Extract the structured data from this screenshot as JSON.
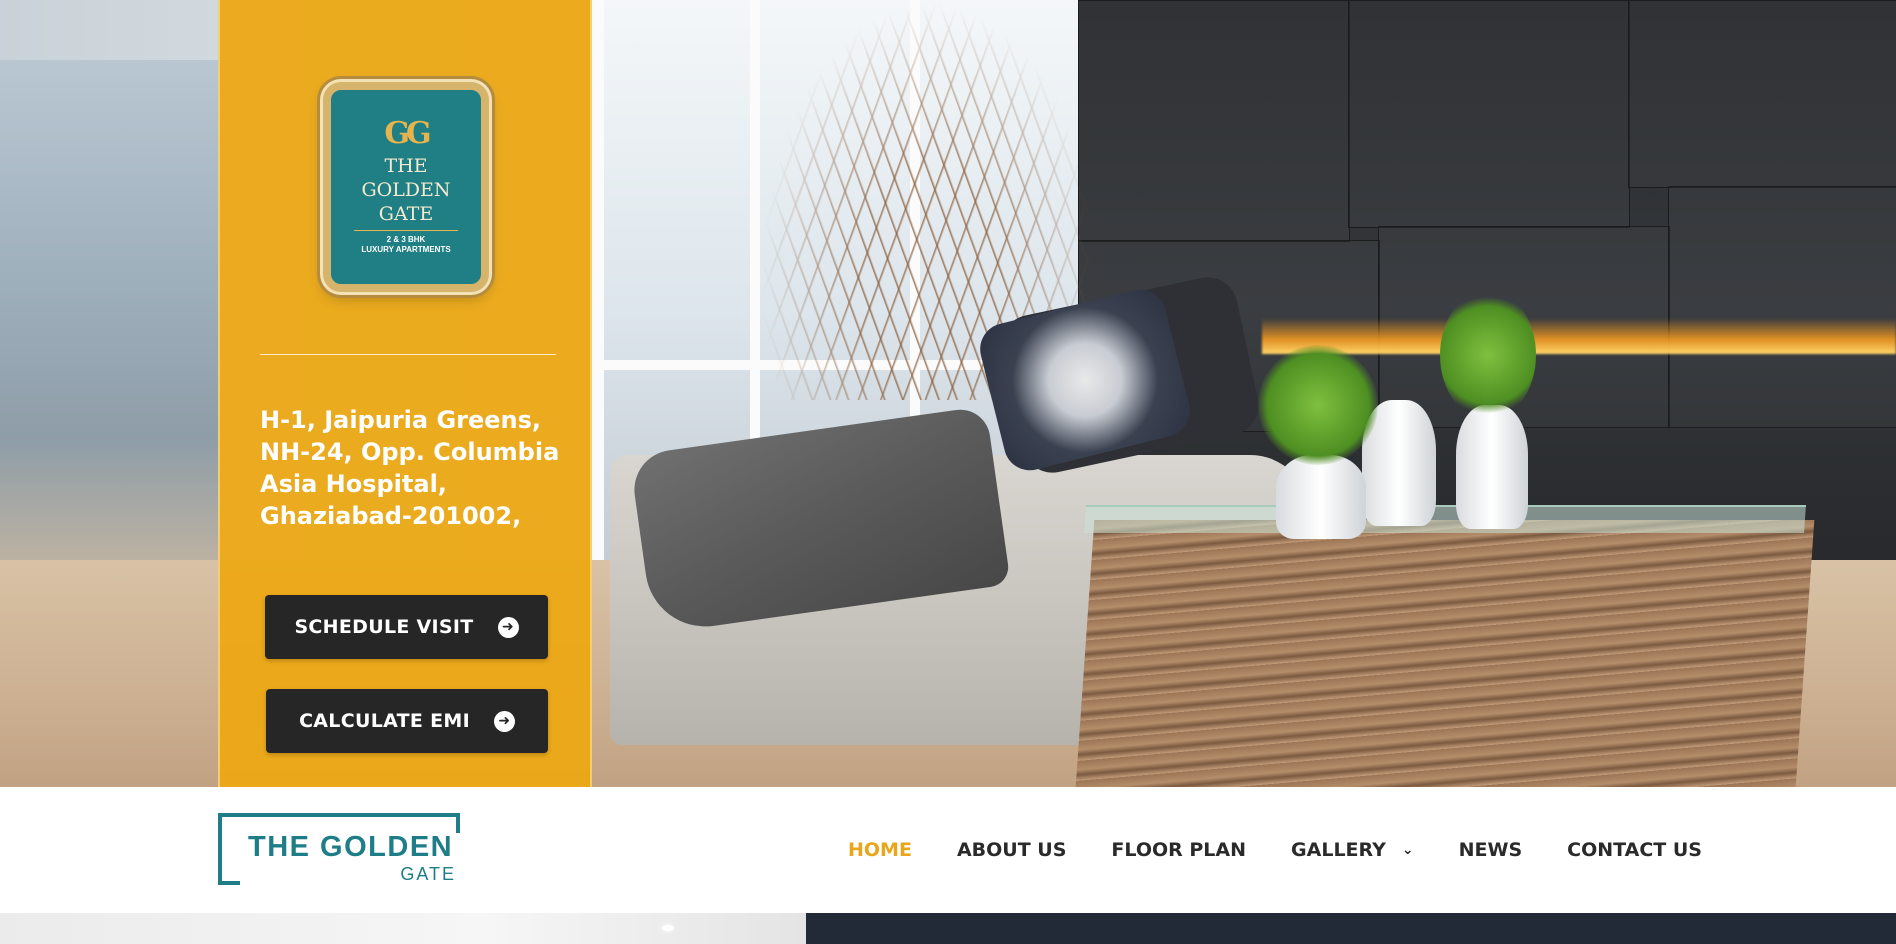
{
  "brand": {
    "emblem": {
      "monogram": "GG",
      "name_line1": "THE",
      "name_line2": "GOLDEN",
      "name_line3": "GATE",
      "tagline_line1": "2 & 3 BHK",
      "tagline_line2": "LUXURY APARTMENTS"
    },
    "logo": {
      "title": "THE GOLDEN",
      "subtitle": "GATE"
    }
  },
  "hero": {
    "address_lines": [
      "H-1, Jaipuria Greens,",
      "NH-24, Opp. Columbia",
      "Asia Hospital,",
      "Ghaziabad-201002,"
    ],
    "buttons": {
      "schedule_visit": "SCHEDULE VISIT",
      "calculate_emi": "CALCULATE EMI"
    },
    "arrow_icon": "arrow-circle-right-icon"
  },
  "nav": {
    "items": [
      {
        "label": "HOME",
        "active": true
      },
      {
        "label": "ABOUT US",
        "active": false
      },
      {
        "label": "FLOOR PLAN",
        "active": false
      },
      {
        "label": "GALLERY",
        "active": false,
        "has_dropdown": true
      },
      {
        "label": "NEWS",
        "active": false
      },
      {
        "label": "CONTACT US",
        "active": false
      }
    ],
    "dropdown_icon": "chevron-down-icon"
  },
  "colors": {
    "panel_yellow": "#eca814",
    "active_nav": "#eaa61b",
    "brand_teal": "#1e7d87",
    "button_dark": "#262626",
    "footer_navy": "#222a38"
  }
}
